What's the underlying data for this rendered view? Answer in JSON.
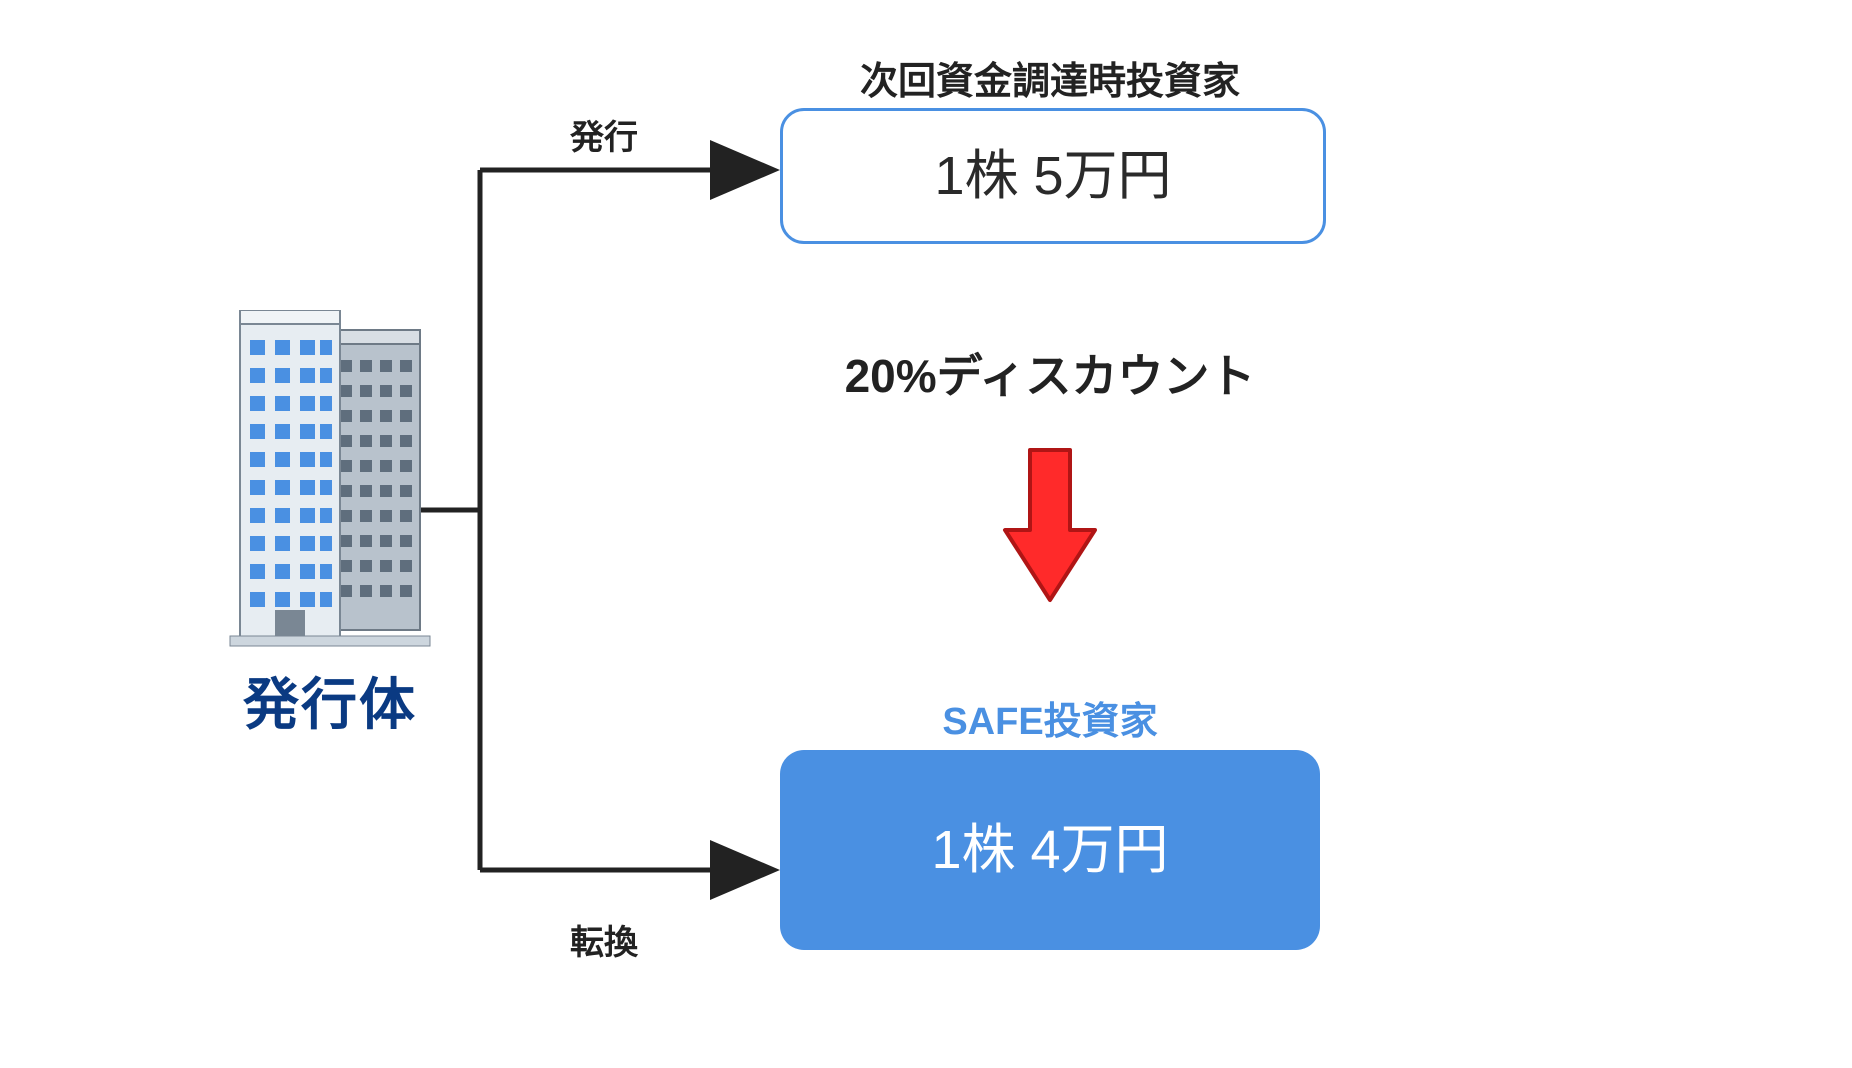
{
  "issuer": {
    "label": "発行体"
  },
  "arrows": {
    "issue_label": "発行",
    "convert_label": "転換"
  },
  "top_investor": {
    "heading": "次回資金調達時投資家",
    "price_text": "1株 5万円"
  },
  "discount": {
    "label": "20%ディスカウント"
  },
  "safe_investor": {
    "heading": "SAFE投資家",
    "price_text": "1株 4万円"
  },
  "colors": {
    "accent_blue": "#4a90e2",
    "dark_blue": "#0a3a82",
    "arrow_red_fill": "#ff2a2a",
    "arrow_red_stroke": "#b01515",
    "line_color": "#222222"
  }
}
